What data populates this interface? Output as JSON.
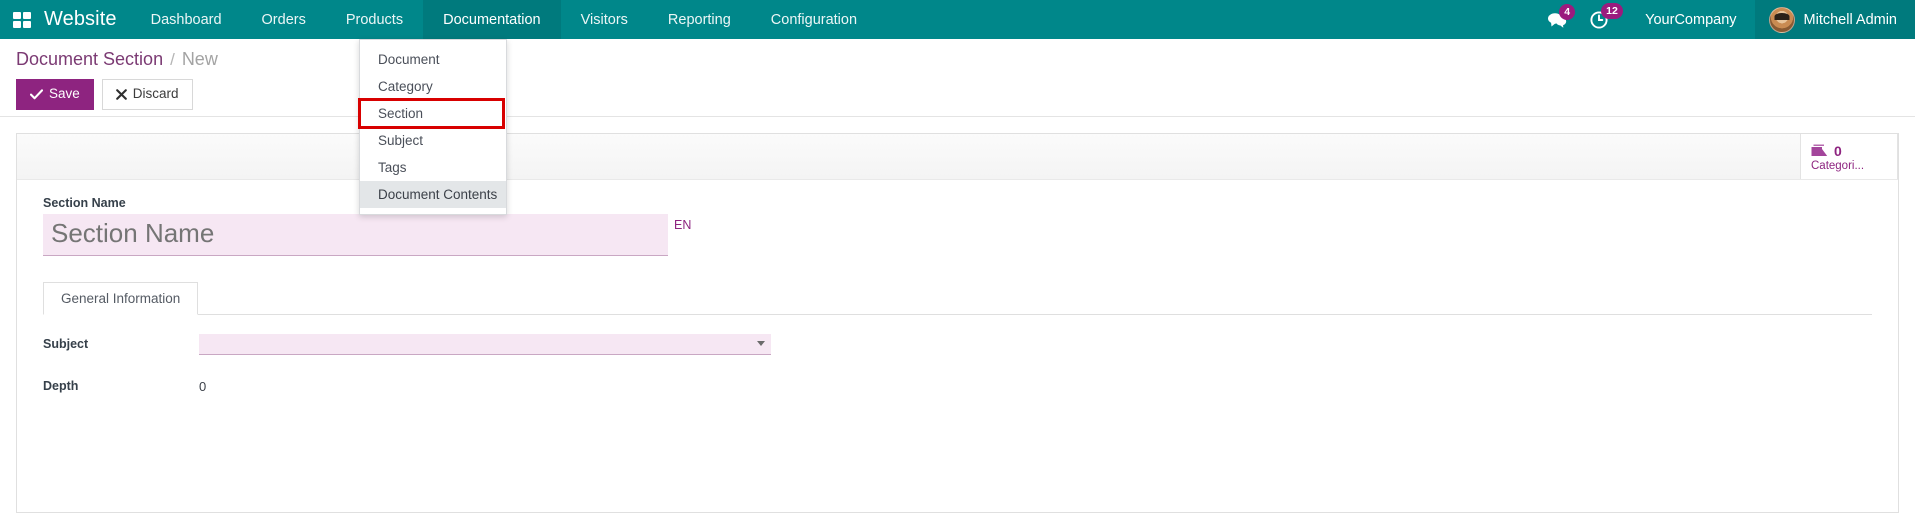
{
  "navbar": {
    "apps_icon": "apps-grid-icon",
    "brand": "Website",
    "items": [
      {
        "label": "Dashboard",
        "active": false
      },
      {
        "label": "Orders",
        "active": false
      },
      {
        "label": "Products",
        "active": false
      },
      {
        "label": "Documentation",
        "active": true
      },
      {
        "label": "Visitors",
        "active": false
      },
      {
        "label": "Reporting",
        "active": false
      },
      {
        "label": "Configuration",
        "active": false
      }
    ],
    "messages_icon": "messages-icon",
    "messages_count": "4",
    "activities_icon": "clock-activity-icon",
    "activities_count": "12",
    "company": "YourCompany",
    "user": "Mitchell Admin",
    "avatar_icon": "avatar"
  },
  "dropdown": {
    "items": [
      {
        "label": "Document",
        "state": "normal"
      },
      {
        "label": "Category",
        "state": "normal"
      },
      {
        "label": "Section",
        "state": "outlined"
      },
      {
        "label": "Subject",
        "state": "normal"
      },
      {
        "label": "Tags",
        "state": "normal"
      },
      {
        "label": "Document Contents",
        "state": "hovered"
      }
    ]
  },
  "control_panel": {
    "breadcrumb_root": "Document Section",
    "breadcrumb_separator": "/",
    "breadcrumb_current": "New",
    "save_label": "Save",
    "save_icon": "check-icon",
    "discard_label": "Discard",
    "discard_icon": "cross-icon"
  },
  "sheet": {
    "stat_button": {
      "icon": "document-pages-icon",
      "value": "0",
      "label": "Categori..."
    },
    "name_field": {
      "label": "Section Name",
      "placeholder": "Section Name",
      "value": "",
      "lang_badge": "EN"
    },
    "notebook": {
      "tabs": [
        {
          "label": "General Information",
          "active": true
        }
      ],
      "fields": [
        {
          "label": "Subject",
          "type": "select",
          "value": "",
          "dropdown_icon": "chevron-down-icon"
        },
        {
          "label": "Depth",
          "type": "text",
          "value": "0"
        }
      ]
    }
  },
  "colors": {
    "navbar_bg": "#00878a",
    "navbar_active": "#007a7d",
    "brand_purple": "#8e2480",
    "badge_pink": "#9b1b7e",
    "field_pink": "#f6e7f3",
    "highlight_red": "#d80000"
  }
}
